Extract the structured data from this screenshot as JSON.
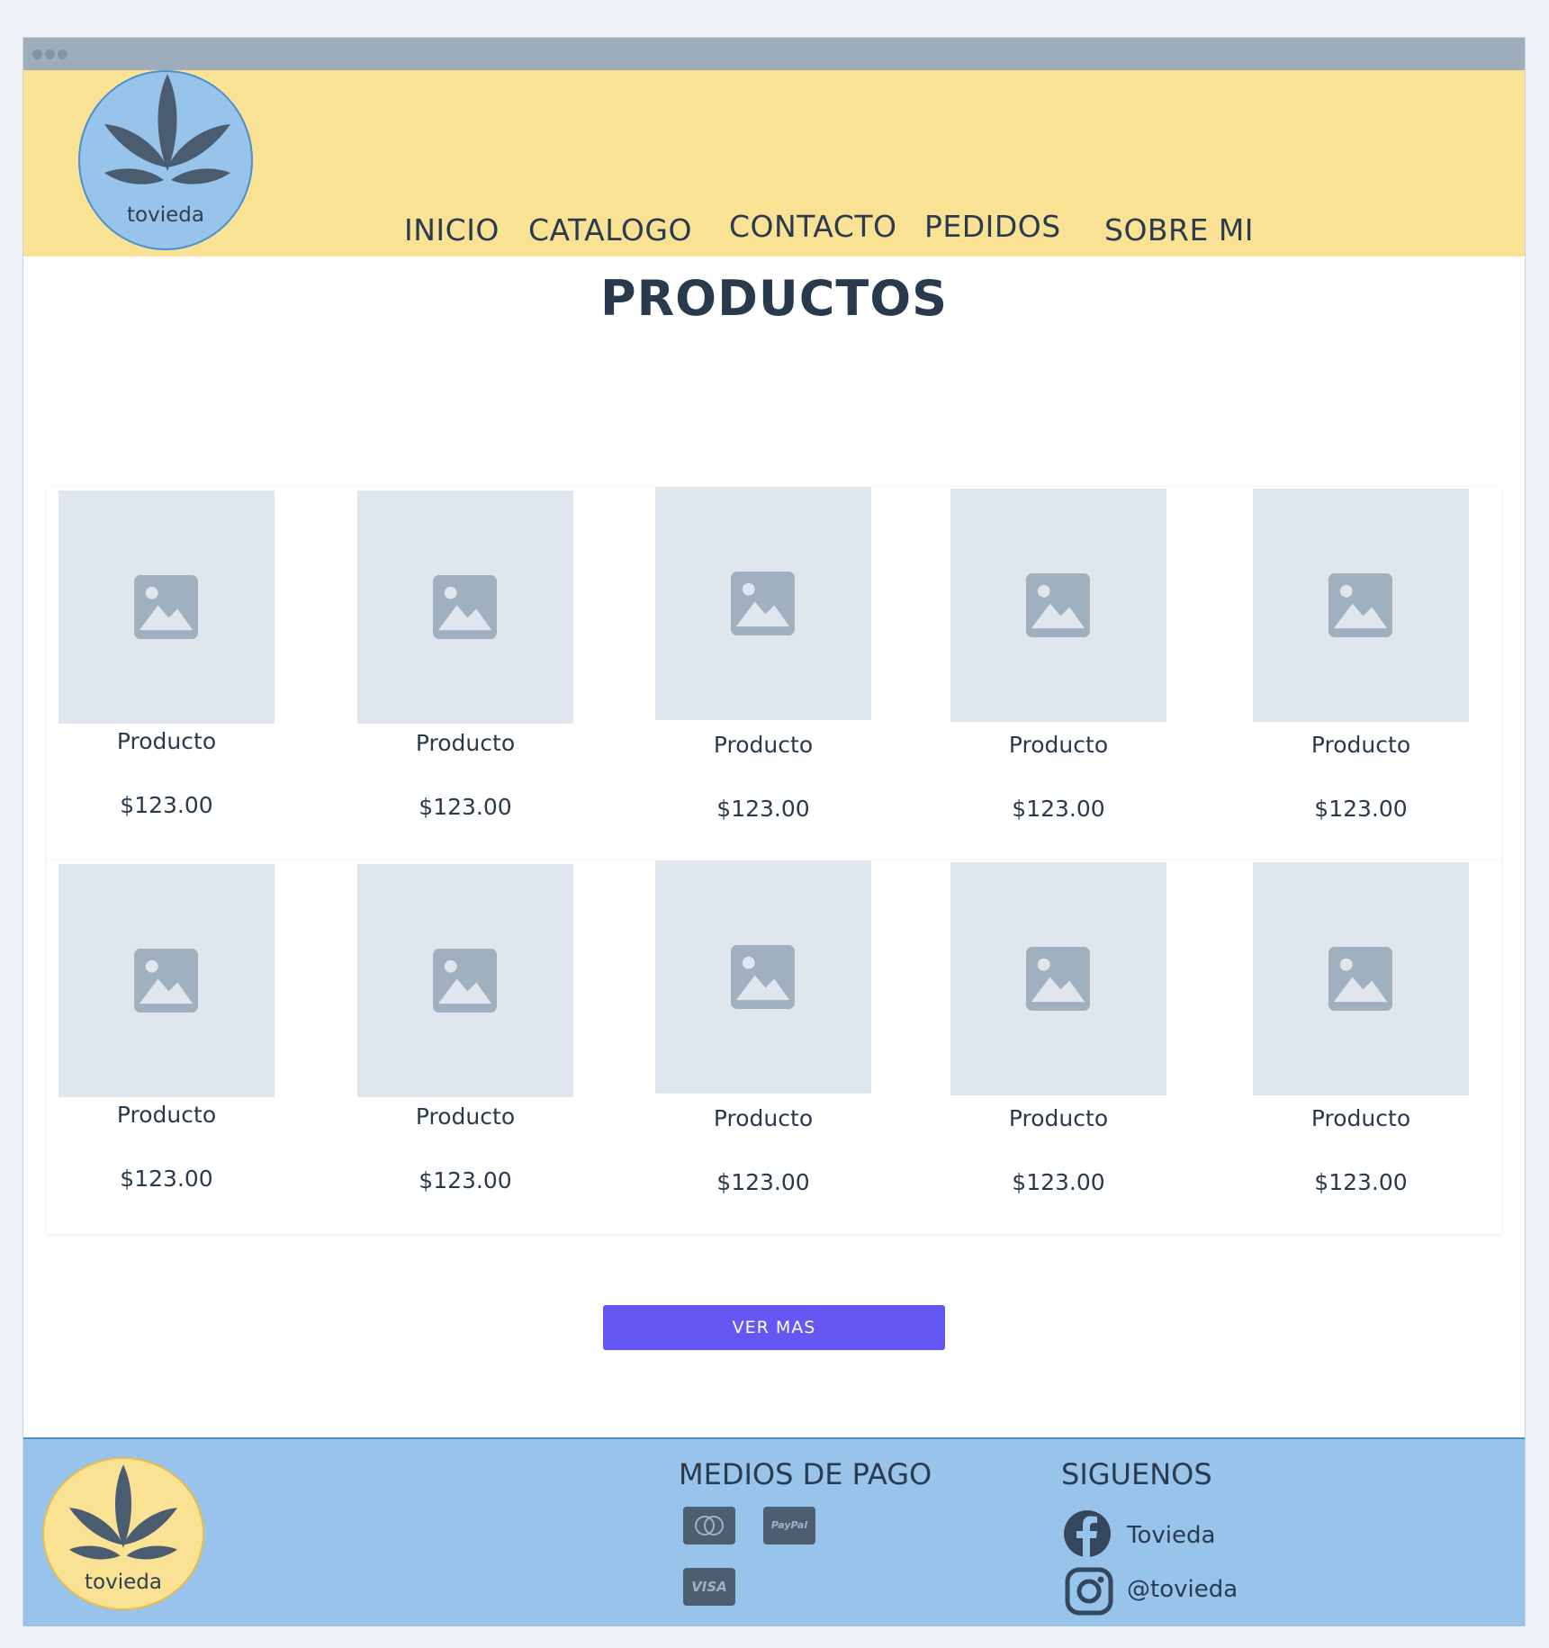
{
  "brand": {
    "name": "tovieda"
  },
  "nav": {
    "items": [
      "INICIO",
      "CATALOGO",
      "CONTACTO",
      "PEDIDOS",
      "SOBRE MI"
    ]
  },
  "main": {
    "title": "PRODUCTOS",
    "products": [
      {
        "name": "Producto",
        "price": "$123.00"
      },
      {
        "name": "Producto",
        "price": "$123.00"
      },
      {
        "name": "Producto",
        "price": "$123.00"
      },
      {
        "name": "Producto",
        "price": "$123.00"
      },
      {
        "name": "Producto",
        "price": "$123.00"
      },
      {
        "name": "Producto",
        "price": "$123.00"
      },
      {
        "name": "Producto",
        "price": "$123.00"
      },
      {
        "name": "Producto",
        "price": "$123.00"
      },
      {
        "name": "Producto",
        "price": "$123.00"
      },
      {
        "name": "Producto",
        "price": "$123.00"
      }
    ],
    "more_button": "VER MAS"
  },
  "footer": {
    "payments_title": "MEDIOS DE PAGO",
    "payments": [
      {
        "icon": "mastercard-icon",
        "label": ""
      },
      {
        "icon": "paypal-icon",
        "label": "PayPal"
      },
      {
        "icon": "visa-icon",
        "label": "VISA"
      }
    ],
    "social_title": "SIGUENOS",
    "social": [
      {
        "icon": "facebook-icon",
        "label": "Tovieda"
      },
      {
        "icon": "instagram-icon",
        "label": "@tovieda"
      }
    ]
  },
  "colors": {
    "header_bg": "#fae294",
    "footer_bg": "#98c3ea",
    "accent_button": "#6457f2",
    "text": "#2a3a4d"
  }
}
